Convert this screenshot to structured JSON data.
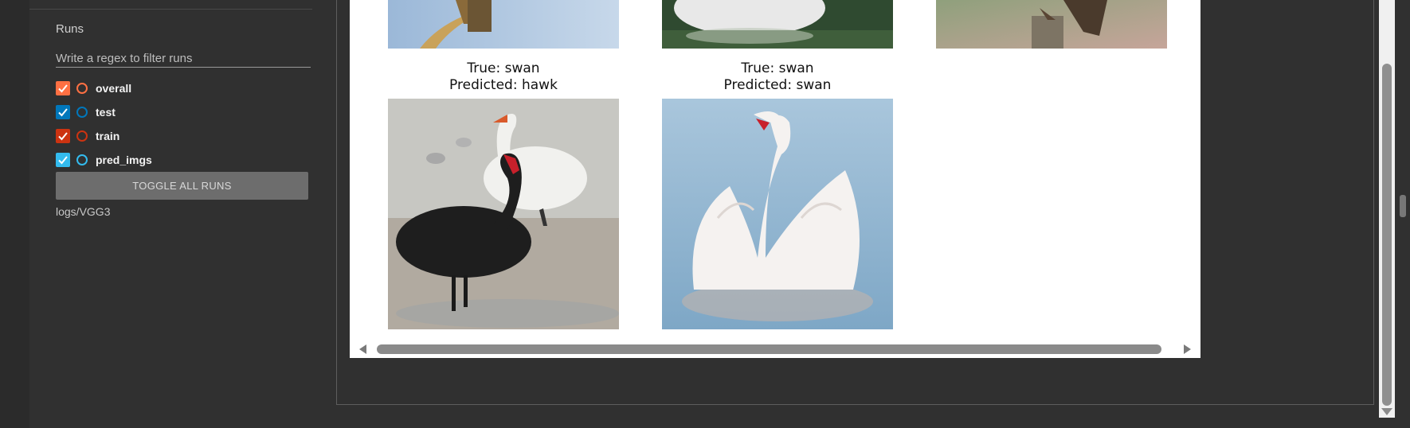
{
  "sidebar": {
    "runs_title": "Runs",
    "filter_placeholder": "Write a regex to filter runs",
    "runs": [
      {
        "label": "overall",
        "color": "#ff7043",
        "checked": true
      },
      {
        "label": "test",
        "color": "#0077bb",
        "checked": true
      },
      {
        "label": "train",
        "color": "#cc3311",
        "checked": true
      },
      {
        "label": "pred_imgs",
        "color": "#33bbee",
        "checked": true
      }
    ],
    "toggle_label": "TOGGLE ALL RUNS",
    "logdir": "logs/VGG3"
  },
  "viewer": {
    "images": [
      {
        "true_label": "True: swan",
        "pred_label": "Predicted: hawk",
        "subject": "black swan and white swan on beach"
      },
      {
        "true_label": "True: swan",
        "pred_label": "Predicted: swan",
        "subject": "white swan on water"
      }
    ],
    "top_row_subjects": [
      "hawk on branch",
      "swan on dark water",
      "hawk on post"
    ]
  },
  "colors": {
    "background": "#303030",
    "viewer_background": "#ffffff",
    "toggle_button": "#6d6d6d"
  },
  "icons": [
    "check-icon",
    "radio-ring-icon",
    "scroll-left-icon",
    "scroll-right-icon",
    "scroll-down-icon"
  ]
}
